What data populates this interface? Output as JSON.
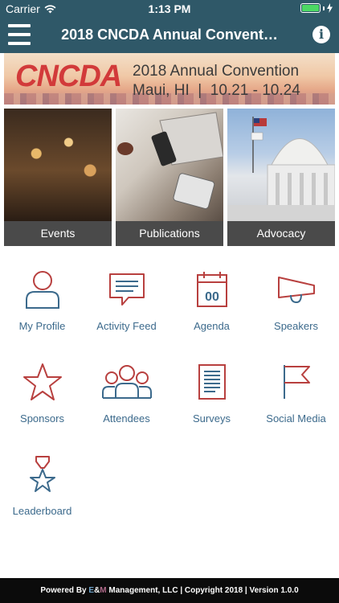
{
  "status_bar": {
    "carrier": "Carrier",
    "time": "1:13 PM"
  },
  "nav": {
    "title": "2018 CNCDA Annual Convent…"
  },
  "banner": {
    "logo": "CNCDA",
    "headline": "2018 Annual Convention",
    "location": "Maui, HI  |  10.21 - 10.24"
  },
  "tiles": [
    {
      "label": "Events"
    },
    {
      "label": "Publications"
    },
    {
      "label": "Advocacy"
    }
  ],
  "menu": [
    {
      "label": "My Profile",
      "icon": "person-icon"
    },
    {
      "label": "Activity Feed",
      "icon": "chat-bubble-icon"
    },
    {
      "label": "Agenda",
      "icon": "calendar-icon"
    },
    {
      "label": "Speakers",
      "icon": "megaphone-icon"
    },
    {
      "label": "Sponsors",
      "icon": "star-icon"
    },
    {
      "label": "Attendees",
      "icon": "group-icon"
    },
    {
      "label": "Surveys",
      "icon": "document-icon"
    },
    {
      "label": "Social Media",
      "icon": "flag-icon"
    },
    {
      "label": "Leaderboard",
      "icon": "medal-icon"
    }
  ],
  "calendar_day": "00",
  "footer": {
    "prefix": "Powered By ",
    "brand_e": "E",
    "brand_amp": "&",
    "brand_m": "M",
    "suffix": " Management, LLC | Copyright 2018 | Version 1.0.0"
  },
  "colors": {
    "nav_bg": "#2f5868",
    "icon_red": "#b8403f",
    "icon_blue": "#3c6a8c",
    "label": "#3c6a8c"
  }
}
